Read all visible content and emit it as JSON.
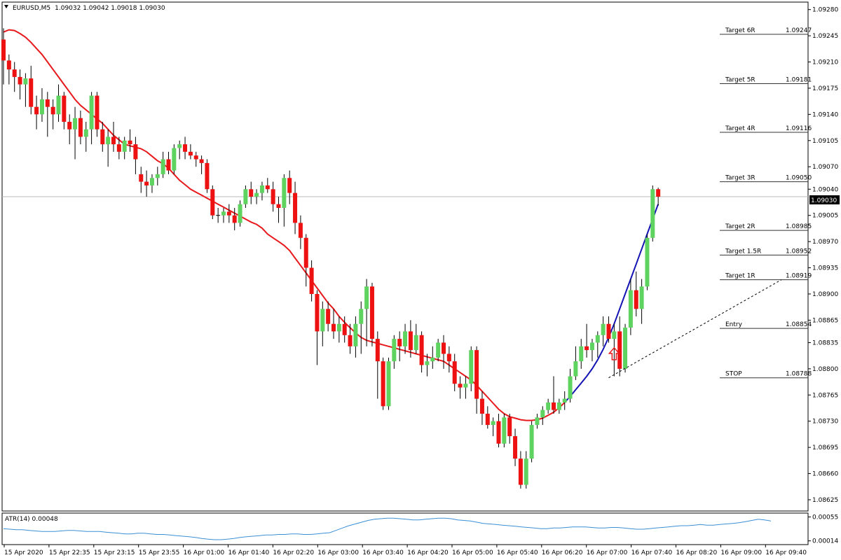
{
  "header": {
    "symbol": "EURUSD,M5",
    "ohlc": "1.09032 1.09042 1.09018 1.09030"
  },
  "colors": {
    "bull": "#5fd35f",
    "bear": "#ee1111",
    "ma_red": "#e8191c",
    "ma_blue": "#1414b4",
    "atr_line": "#3a8fd6",
    "levels": "#333333",
    "price_tag_bg": "#000000"
  },
  "current_price_label": "1.09030",
  "chart_data": {
    "type": "candlestick",
    "symbol": "EURUSD",
    "timeframe": "M5",
    "y_axis": {
      "range": [
        1.0861,
        1.0929
      ],
      "ticks": [
        "1.09280",
        "1.09245",
        "1.09210",
        "1.09175",
        "1.09140",
        "1.09105",
        "1.09070",
        "1.09040",
        "1.09005",
        "1.08970",
        "1.08935",
        "1.08900",
        "1.08865",
        "1.08835",
        "1.08800",
        "1.08765",
        "1.08730",
        "1.08695",
        "1.08660",
        "1.08625"
      ]
    },
    "x_axis": {
      "ticks": [
        "15 Apr 2020",
        "15 Apr 22:35",
        "15 Apr 23:15",
        "15 Apr 23:55",
        "16 Apr 01:00",
        "16 Apr 01:40",
        "16 Apr 02:20",
        "16 Apr 03:00",
        "16 Apr 03:40",
        "16 Apr 04:20",
        "16 Apr 05:00",
        "16 Apr 05:40",
        "16 Apr 06:20",
        "16 Apr 07:00",
        "16 Apr 07:40",
        "16 Apr 08:20",
        "16 Apr 09:00",
        "16 Apr 09:40"
      ]
    },
    "candles": [
      [
        1.0924,
        1.09255,
        1.0918,
        1.09212
      ],
      [
        1.09212,
        1.0922,
        1.0918,
        1.092
      ],
      [
        1.092,
        1.0921,
        1.0917,
        1.0919
      ],
      [
        1.0919,
        1.092,
        1.0916,
        1.0918
      ],
      [
        1.0918,
        1.09195,
        1.0915,
        1.09188
      ],
      [
        1.09188,
        1.09205,
        1.0914,
        1.0915
      ],
      [
        1.0915,
        1.09165,
        1.0912,
        1.0914
      ],
      [
        1.0914,
        1.09175,
        1.0913,
        1.0916
      ],
      [
        1.0916,
        1.0917,
        1.0911,
        1.0915
      ],
      [
        1.0915,
        1.0916,
        1.0912,
        1.0914
      ],
      [
        1.0914,
        1.0918,
        1.0913,
        1.09165
      ],
      [
        1.09165,
        1.0917,
        1.0912,
        1.0913
      ],
      [
        1.0913,
        1.0914,
        1.091,
        1.0912
      ],
      [
        1.0912,
        1.0915,
        1.0908,
        1.09135
      ],
      [
        1.09135,
        1.09145,
        1.091,
        1.0911
      ],
      [
        1.0911,
        1.0913,
        1.0909,
        1.0912
      ],
      [
        1.0912,
        1.0917,
        1.091,
        1.09165
      ],
      [
        1.09165,
        1.0917,
        1.0911,
        1.0912
      ],
      [
        1.0912,
        1.0913,
        1.0909,
        1.091
      ],
      [
        1.091,
        1.0912,
        1.0907,
        1.0911
      ],
      [
        1.0911,
        1.0913,
        1.0909,
        1.091
      ],
      [
        1.091,
        1.0911,
        1.0908,
        1.0909
      ],
      [
        1.0909,
        1.0911,
        1.0908,
        1.09105
      ],
      [
        1.09105,
        1.0912,
        1.0909,
        1.091
      ],
      [
        1.091,
        1.0911,
        1.0906,
        1.0908
      ],
      [
        1.0906,
        1.0907,
        1.09035,
        1.0905
      ],
      [
        1.0905,
        1.09065,
        1.0903,
        1.09045
      ],
      [
        1.09045,
        1.0906,
        1.09035,
        1.09055
      ],
      [
        1.09055,
        1.0907,
        1.09045,
        1.0906
      ],
      [
        1.0906,
        1.0909,
        1.09055,
        1.0908
      ],
      [
        1.0908,
        1.0909,
        1.0906,
        1.09065
      ],
      [
        1.09065,
        1.091,
        1.0906,
        1.09095
      ],
      [
        1.09095,
        1.09105,
        1.0908,
        1.091
      ],
      [
        1.091,
        1.0911,
        1.0908,
        1.0909
      ],
      [
        1.0909,
        1.091,
        1.0908,
        1.09085
      ],
      [
        1.09085,
        1.0909,
        1.0907,
        1.0908
      ],
      [
        1.0908,
        1.09085,
        1.0906,
        1.09075
      ],
      [
        1.09075,
        1.0908,
        1.09035,
        1.0904
      ],
      [
        1.0904,
        1.09045,
        1.09,
        1.09005
      ],
      [
        1.09005,
        1.09015,
        1.08995,
        1.09005
      ],
      [
        1.09005,
        1.09015,
        1.08995,
        1.0901
      ],
      [
        1.0901,
        1.0902,
        1.08995,
        1.09005
      ],
      [
        1.09005,
        1.09015,
        1.08985,
        1.08995
      ],
      [
        1.08995,
        1.09025,
        1.0899,
        1.0902
      ],
      [
        1.0902,
        1.09045,
        1.09015,
        1.0904
      ],
      [
        1.0904,
        1.0905,
        1.0902,
        1.0903
      ],
      [
        1.0903,
        1.0904,
        1.0902,
        1.09035
      ],
      [
        1.09035,
        1.0905,
        1.09025,
        1.09045
      ],
      [
        1.09045,
        1.09055,
        1.09035,
        1.0904
      ],
      [
        1.0904,
        1.0905,
        1.0901,
        1.0902
      ],
      [
        1.0902,
        1.0903,
        1.08995,
        1.09015
      ],
      [
        1.09015,
        1.0906,
        1.0899,
        1.09055
      ],
      [
        1.09055,
        1.09065,
        1.0902,
        1.09035
      ],
      [
        1.09035,
        1.0905,
        1.0898,
        1.08995
      ],
      [
        1.08995,
        1.09005,
        1.0896,
        1.08975
      ],
      [
        1.08975,
        1.0898,
        1.0891,
        1.08935
      ],
      [
        1.08935,
        1.08945,
        1.0889,
        1.089
      ],
      [
        1.089,
        1.08905,
        1.08805,
        1.0885
      ],
      [
        1.0885,
        1.0889,
        1.0883,
        1.0888
      ],
      [
        1.0888,
        1.0889,
        1.0885,
        1.0886
      ],
      [
        1.0886,
        1.0888,
        1.0884,
        1.0885
      ],
      [
        1.0885,
        1.0887,
        1.08835,
        1.0886
      ],
      [
        1.0886,
        1.0887,
        1.08835,
        1.08845
      ],
      [
        1.08845,
        1.0886,
        1.0882,
        1.0883
      ],
      [
        1.0883,
        1.0887,
        1.08815,
        1.0886
      ],
      [
        1.0886,
        1.0889,
        1.0882,
        1.0888
      ],
      [
        1.0888,
        1.0892,
        1.0883,
        1.0891
      ],
      [
        1.0891,
        1.08915,
        1.0883,
        1.0884
      ],
      [
        1.0884,
        1.0885,
        1.0876,
        1.0881
      ],
      [
        1.0881,
        1.08815,
        1.08745,
        1.0875
      ],
      [
        1.0875,
        1.08815,
        1.08745,
        1.0881
      ],
      [
        1.0881,
        1.08845,
        1.088,
        1.0884
      ],
      [
        1.0884,
        1.0885,
        1.0881,
        1.0883
      ],
      [
        1.0883,
        1.0886,
        1.0882,
        1.0885
      ],
      [
        1.0885,
        1.08865,
        1.08815,
        1.08825
      ],
      [
        1.08825,
        1.0886,
        1.0882,
        1.08845
      ],
      [
        1.08845,
        1.0885,
        1.08795,
        1.08805
      ],
      [
        1.08805,
        1.0882,
        1.0879,
        1.0881
      ],
      [
        1.0881,
        1.0883,
        1.088,
        1.08815
      ],
      [
        1.08815,
        1.0884,
        1.0881,
        1.08835
      ],
      [
        1.08835,
        1.08845,
        1.088,
        1.0882
      ],
      [
        1.0882,
        1.0883,
        1.08795,
        1.0881
      ],
      [
        1.0881,
        1.0882,
        1.0877,
        1.0878
      ],
      [
        1.0878,
        1.0879,
        1.0876,
        1.08775
      ],
      [
        1.08775,
        1.0879,
        1.0876,
        1.0878
      ],
      [
        1.0878,
        1.0883,
        1.0877,
        1.08825
      ],
      [
        1.08825,
        1.0883,
        1.0874,
        1.0876
      ],
      [
        1.0876,
        1.0877,
        1.08725,
        1.0874
      ],
      [
        1.0874,
        1.0875,
        1.0872,
        1.08725
      ],
      [
        1.08725,
        1.08735,
        1.0871,
        1.0873
      ],
      [
        1.0873,
        1.0874,
        1.08695,
        1.087
      ],
      [
        1.087,
        1.0874,
        1.08695,
        1.08735
      ],
      [
        1.08735,
        1.0874,
        1.087,
        1.0871
      ],
      [
        1.0871,
        1.0872,
        1.0867,
        1.0868
      ],
      [
        1.0868,
        1.0869,
        1.0864,
        1.08645
      ],
      [
        1.08645,
        1.0869,
        1.0864,
        1.0868
      ],
      [
        1.0868,
        1.0873,
        1.08675,
        1.08725
      ],
      [
        1.08725,
        1.0874,
        1.0872,
        1.08735
      ],
      [
        1.08735,
        1.0875,
        1.08725,
        1.08745
      ],
      [
        1.08745,
        1.0876,
        1.0874,
        1.08755
      ],
      [
        1.08755,
        1.0879,
        1.0874,
        1.08745
      ],
      [
        1.08745,
        1.0876,
        1.0874,
        1.08755
      ],
      [
        1.08755,
        1.0877,
        1.08745,
        1.0876
      ],
      [
        1.0876,
        1.088,
        1.08755,
        1.0879
      ],
      [
        1.0879,
        1.0883,
        1.08785,
        1.0881
      ],
      [
        1.0881,
        1.0884,
        1.088,
        1.0883
      ],
      [
        1.0883,
        1.0886,
        1.08815,
        1.08825
      ],
      [
        1.08825,
        1.0884,
        1.0881,
        1.08835
      ],
      [
        1.08835,
        1.0885,
        1.08815,
        1.08845
      ],
      [
        1.08845,
        1.0887,
        1.0883,
        1.0886
      ],
      [
        1.0886,
        1.0887,
        1.08835,
        1.0884
      ],
      [
        1.0884,
        1.0886,
        1.0879,
        1.0885
      ],
      [
        1.0885,
        1.0887,
        1.0879,
        1.088
      ],
      [
        1.088,
        1.0886,
        1.08795,
        1.08855
      ],
      [
        1.08855,
        1.0892,
        1.08845,
        1.08905
      ],
      [
        1.08905,
        1.0893,
        1.0887,
        1.0888
      ],
      [
        1.0888,
        1.0892,
        1.0886,
        1.0891
      ],
      [
        1.0891,
        1.0898,
        1.08905,
        1.08975
      ],
      [
        1.08975,
        1.09045,
        1.0897,
        1.0904
      ],
      [
        1.0904,
        1.09042,
        1.09018,
        1.0903
      ]
    ],
    "moving_average_red": [
      1.0925,
      1.09253,
      1.09252,
      1.09248,
      1.09243,
      1.09236,
      1.09228,
      1.0922,
      1.0921,
      1.092,
      1.0919,
      1.0918,
      1.0917,
      1.0916,
      1.09152,
      1.09146,
      1.0914,
      1.09134,
      1.09128,
      1.0912,
      1.09112,
      1.09106,
      1.091,
      1.09098,
      1.09096,
      1.09094,
      1.0909,
      1.09084,
      1.09078,
      1.09074,
      1.09068,
      1.0906,
      1.09052,
      1.09046,
      1.0904,
      1.09036,
      1.09032,
      1.09028,
      1.09024,
      1.0902,
      1.09016,
      1.09012,
      1.09008,
      1.09004,
      1.09,
      1.08996,
      1.08993,
      1.08988,
      1.0898,
      1.08975,
      1.0897,
      1.08965,
      1.08958,
      1.08948,
      1.08938,
      1.08928,
      1.08918,
      1.08908,
      1.08898,
      1.08888,
      1.0888,
      1.0887,
      1.08862,
      1.08855,
      1.08848,
      1.08842,
      1.08838,
      1.08836,
      1.08834,
      1.08832,
      1.0883,
      1.08828,
      1.08826,
      1.08824,
      1.08822,
      1.0882,
      1.08818,
      1.08816,
      1.08814,
      1.08812,
      1.0881,
      1.08805,
      1.088,
      1.08795,
      1.0879,
      1.08785,
      1.08778,
      1.0877,
      1.08762,
      1.08754,
      1.08746,
      1.0874,
      1.08736,
      1.08734,
      1.08732,
      1.08731,
      1.08731,
      1.08732,
      1.08734,
      1.08738,
      1.08742,
      1.08748,
      1.08755,
      1.08763,
      1.08772,
      1.08781,
      1.0879,
      1.088,
      1.08812,
      1.08826,
      1.08842,
      1.0886,
      1.0888,
      1.089,
      1.0892,
      1.0894,
      1.0896,
      1.0898,
      1.09,
      1.0902
    ],
    "moving_average_blue_from_index": 102,
    "levels": [
      {
        "label": "Target 6R",
        "value": "1.09247",
        "price": 1.09247
      },
      {
        "label": "Target 5R",
        "value": "1.09181",
        "price": 1.09181
      },
      {
        "label": "Target 4R",
        "value": "1.09116",
        "price": 1.09116
      },
      {
        "label": "Target 3R",
        "value": "1.09050",
        "price": 1.0905
      },
      {
        "label": "Target 2R",
        "value": "1.08985",
        "price": 1.08985
      },
      {
        "label": "Target 1.5R",
        "value": "1.08952",
        "price": 1.08952
      },
      {
        "label": "Target 1R",
        "value": "1.08919",
        "price": 1.08919
      },
      {
        "label": "Entry",
        "value": "1.08854",
        "price": 1.08854
      },
      {
        "label": "STOP",
        "value": "1.08788",
        "price": 1.08788
      }
    ],
    "current_price": 1.0903,
    "atr": {
      "label": "ATR(14) 0.00048",
      "range": [
        0.0001,
        0.00058
      ],
      "ticks": [
        "0.00055",
        "0.00014"
      ],
      "values": [
        0.00035,
        0.00034,
        0.00033,
        0.00033,
        0.00032,
        0.00031,
        0.0003,
        0.0003,
        0.0003,
        0.00031,
        0.00032,
        0.00032,
        0.00031,
        0.0003,
        0.0003,
        0.0003,
        0.00029,
        0.00028,
        0.00027,
        0.00026,
        0.00026,
        0.00027,
        0.00027,
        0.00026,
        0.00025,
        0.00025,
        0.00024,
        0.00023,
        0.00022,
        0.00021,
        0.0002,
        0.00018,
        0.00017,
        0.00016,
        0.00016,
        0.00017,
        0.00018,
        0.0002,
        0.00021,
        0.00022,
        0.00023,
        0.00024,
        0.00024,
        0.00025,
        0.00025,
        0.00026,
        0.00026,
        0.00025,
        0.00025,
        0.00026,
        0.00027,
        0.00028,
        0.00032,
        0.00036,
        0.0004,
        0.00043,
        0.00046,
        0.00049,
        0.00051,
        0.00052,
        0.00053,
        0.00053,
        0.00052,
        0.00051,
        0.0005,
        0.0005,
        0.00051,
        0.00052,
        0.00053,
        0.00053,
        0.00052,
        0.0005,
        0.00049,
        0.00048,
        0.00046,
        0.00044,
        0.00043,
        0.00042,
        0.00041,
        0.0004,
        0.00039,
        0.00038,
        0.00037,
        0.00036,
        0.00035,
        0.00035,
        0.00036,
        0.00036,
        0.00037,
        0.00038,
        0.00038,
        0.00038,
        0.00037,
        0.00036,
        0.00036,
        0.00037,
        0.00037,
        0.00036,
        0.00035,
        0.00034,
        0.00034,
        0.00035,
        0.00036,
        0.00037,
        0.00038,
        0.00039,
        0.0004,
        0.0004,
        0.00041,
        0.00042,
        0.00041,
        0.00041,
        0.00042,
        0.00043,
        0.00044,
        0.00045,
        0.00047,
        0.00049,
        0.00051,
        0.0005,
        0.00048
      ]
    }
  }
}
